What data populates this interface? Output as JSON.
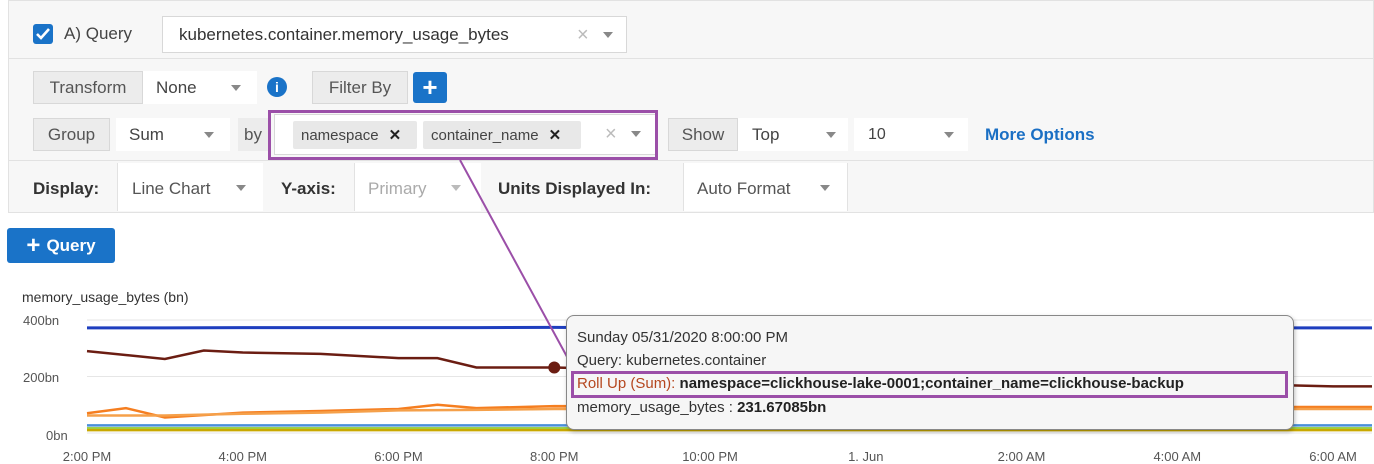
{
  "query": {
    "checkbox_checked": true,
    "label": "A) Query",
    "metric": "kubernetes.container.memory_usage_bytes"
  },
  "transform": {
    "label": "Transform",
    "value": "None",
    "filter_label": "Filter By"
  },
  "group": {
    "label": "Group",
    "agg": "Sum",
    "by_label": "by",
    "tags": [
      "namespace",
      "container_name"
    ],
    "show_label": "Show",
    "show_value": "Top",
    "count_value": "10",
    "more_options": "More Options"
  },
  "display": {
    "label": "Display:",
    "value": "Line Chart",
    "yaxis_label": "Y-axis:",
    "yaxis_value": "Primary",
    "units_label": "Units Displayed In:",
    "units_value": "Auto Format"
  },
  "add_query_label": "Query",
  "chart_data": {
    "type": "line",
    "ylabel": "memory_usage_bytes (bn)",
    "ylim": [
      0,
      400
    ],
    "y_ticks": [
      "400bn",
      "200bn",
      "0bn"
    ],
    "x_ticks": [
      "2:00 PM",
      "4:00 PM",
      "6:00 PM",
      "8:00 PM",
      "10:00 PM",
      "1. Jun",
      "2:00 AM",
      "4:00 AM",
      "6:00 AM"
    ],
    "series": [
      {
        "color": "#1f3fbf",
        "x": [
          14,
          15,
          16,
          17,
          18,
          19,
          20,
          21,
          30.5
        ],
        "values": [
          372,
          372,
          373,
          373,
          373,
          373,
          374,
          372,
          372
        ]
      },
      {
        "color": "#6b1d12",
        "x": [
          14,
          15,
          15.5,
          16,
          17,
          18,
          18.5,
          19,
          20,
          30,
          30.5
        ],
        "values": [
          290,
          262,
          292,
          285,
          280,
          265,
          265,
          232,
          232,
          165,
          165
        ]
      },
      {
        "color": "#f57e20",
        "x": [
          14,
          14.5,
          15,
          16,
          17,
          18,
          18.5,
          19,
          20,
          30,
          30.5
        ],
        "values": [
          70,
          88,
          55,
          72,
          78,
          85,
          100,
          88,
          95,
          92,
          92
        ]
      },
      {
        "color": "#f5a04a",
        "x": [
          14,
          15,
          16,
          17,
          18,
          19,
          20,
          30.5
        ],
        "values": [
          62,
          62,
          68,
          72,
          80,
          82,
          85,
          85
        ]
      },
      {
        "color": "#4a90d9",
        "x": [
          14,
          30.5
        ],
        "values": [
          27,
          27
        ]
      },
      {
        "color": "#9bd14a",
        "x": [
          14,
          30.5
        ],
        "values": [
          17,
          17
        ]
      },
      {
        "color": "#c9a800",
        "x": [
          14,
          30.5
        ],
        "values": [
          10,
          10
        ]
      }
    ],
    "highlight_point": {
      "x": 20,
      "y": 231.67085,
      "color": "#6b1d12"
    }
  },
  "tooltip": {
    "date": "Sunday 05/31/2020 8:00:00 PM",
    "query_line": "Query: kubernetes.container",
    "rollup_prefix": "Roll Up (Sum):",
    "rollup_value": "namespace=clickhouse-lake-0001;container_name=clickhouse-backup",
    "metric_prefix": "memory_usage_bytes :",
    "metric_value": "231.67085bn"
  },
  "annotation": {
    "color": "#9b4fa8"
  }
}
